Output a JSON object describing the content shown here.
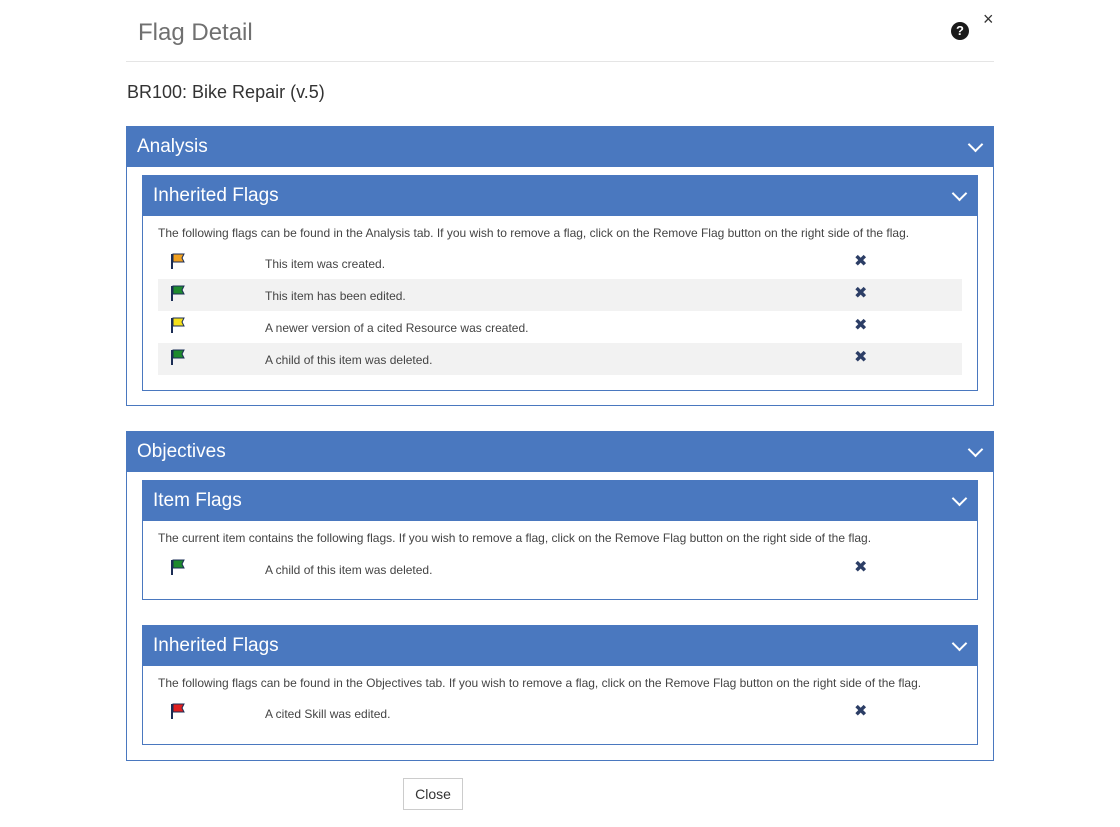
{
  "dialog": {
    "title": "Flag Detail",
    "help_icon": "question-circle-icon",
    "close_glyph": "×",
    "item_title": "BR100: Bike Repair (v.5)",
    "close_button": "Close"
  },
  "sections": [
    {
      "title": "Analysis",
      "subsections": [
        {
          "title": "Inherited Flags",
          "description": "The following flags can be found in the Analysis tab. If you wish to remove a flag, click on the Remove Flag button on the right side of the flag.",
          "flags": [
            {
              "text": "This item was created.",
              "color": "#f0a020"
            },
            {
              "text": "This item has been edited.",
              "color": "#1e8a2e"
            },
            {
              "text": "A newer version of a cited Resource was created.",
              "color": "#f5e01a"
            },
            {
              "text": "A child of this item was deleted.",
              "color": "#1e8a2e"
            }
          ]
        }
      ]
    },
    {
      "title": "Objectives",
      "subsections": [
        {
          "title": "Item Flags",
          "description": "The current item contains the following flags. If you wish to remove a flag, click on the Remove Flag button on the right side of the flag.",
          "flags": [
            {
              "text": "A child of this item was deleted.",
              "color": "#1e8a2e"
            }
          ]
        },
        {
          "title": "Inherited Flags",
          "description": "The following flags can be found in the Objectives tab. If you wish to remove a flag, click on the Remove Flag button on the right side of the flag.",
          "flags": [
            {
              "text": "A cited Skill was edited.",
              "color": "#e02020"
            }
          ]
        }
      ]
    }
  ],
  "remove_glyph": "✖",
  "colors": {
    "accent": "#4a78bf",
    "remove_icon": "#2c3e66",
    "row_alt": "#f2f2f2"
  }
}
